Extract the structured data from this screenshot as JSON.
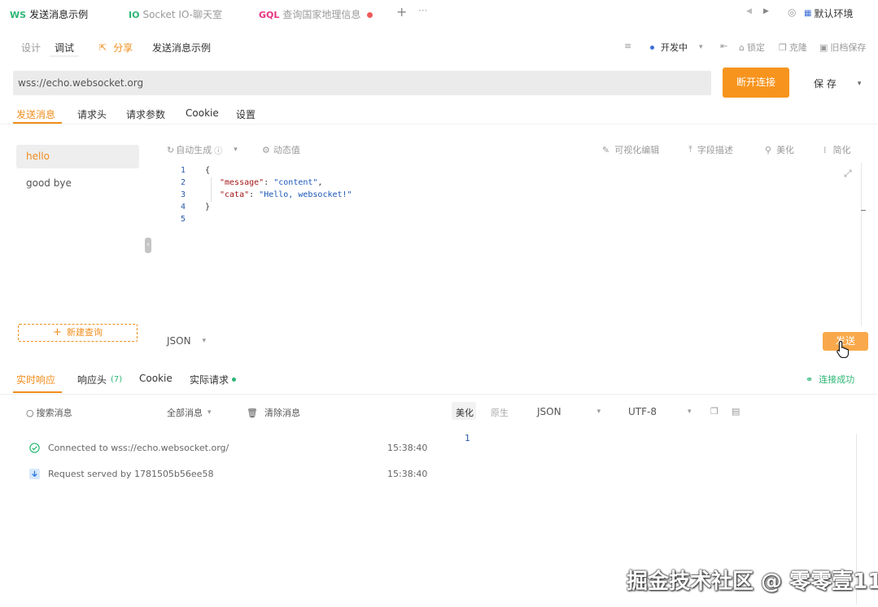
{
  "tabs": [
    {
      "badge": "WS",
      "label": "发送消息示例"
    },
    {
      "badge": "IO",
      "label": "Socket IO-聊天室"
    },
    {
      "badge": "GQL",
      "label": "查询国家地理信息"
    }
  ],
  "environment": "默认环境",
  "mode_tabs": {
    "design": "设计",
    "debug": "调试"
  },
  "share": "分享",
  "doc_title": "发送消息示例",
  "status": "开发中",
  "actions": {
    "lock": "锁定",
    "clone": "克隆",
    "save_old": "旧档保存"
  },
  "url": "wss://echo.websocket.org",
  "disconnect": "断开连接",
  "save": "保 存",
  "request_tabs": [
    "发送消息",
    "请求头",
    "请求参数",
    "Cookie",
    "设置"
  ],
  "queries": [
    "hello",
    "good bye"
  ],
  "new_query": "新建查询",
  "editor_tools": {
    "auto_gen": "自动生成",
    "dynamic": "动态值",
    "visual_edit": "可视化编辑",
    "field_desc": "字段描述",
    "beautify": "美化",
    "simplify": "简化"
  },
  "code_lines": [
    "1",
    "2",
    "3",
    "4",
    "5"
  ],
  "code": {
    "open": "{",
    "k1": "\"message\"",
    "v1": "\"content\"",
    "k2": "\"cata\"",
    "v2": "\"Hello, websocket!\"",
    "close": "}"
  },
  "format": "JSON",
  "send": "发送",
  "response_tabs": {
    "live": "实时响应",
    "headers": "响应头",
    "headers_count": "(7)",
    "cookie": "Cookie",
    "actual": "实际请求"
  },
  "conn_status": "连接成功",
  "msg_tools": {
    "search_placeholder": "搜索消息",
    "filter": "全部消息",
    "clear": "清除消息"
  },
  "view_tools": {
    "beautify": "美化",
    "raw": "原生",
    "format": "JSON",
    "encoding": "UTF-8"
  },
  "messages": [
    {
      "text": "Connected to wss://echo.websocket.org/",
      "time": "15:38:40",
      "icon": "check-circle-icon"
    },
    {
      "text": "Request served by 1781505b56ee58",
      "time": "15:38:40",
      "icon": "arrow-down-icon"
    }
  ],
  "response_line": "1",
  "watermark": "掘金技术社区 @ 零零壹11",
  "colors": {
    "accent": "#f7941d",
    "success": "#2bb673",
    "gql": "#e5317f"
  }
}
